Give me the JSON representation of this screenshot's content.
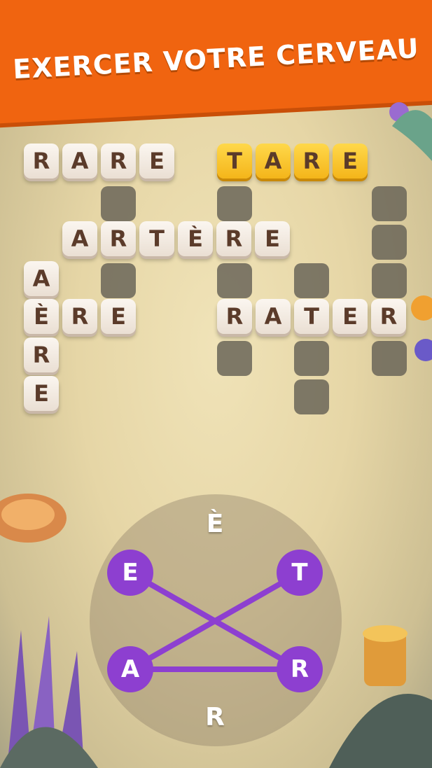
{
  "banner": {
    "title": "EXERCER VOTRE CERVEAU"
  },
  "board": {
    "words": [
      {
        "word": "RARE",
        "letters": [
          "R",
          "A",
          "R",
          "E"
        ]
      },
      {
        "word": "TARE",
        "letters": [
          "T",
          "A",
          "R",
          "E"
        ],
        "status": "highlighted"
      },
      {
        "word": "ARTÈRE",
        "letters": [
          "A",
          "R",
          "T",
          "È",
          "R",
          "E"
        ]
      },
      {
        "word": "AÈRE",
        "letters": [
          "A",
          "È",
          "R",
          "E"
        ]
      },
      {
        "word": "ÈRE",
        "letters": [
          "È",
          "R",
          "E"
        ]
      },
      {
        "word": "RATER",
        "letters": [
          "R",
          "A",
          "T",
          "E",
          "R"
        ]
      }
    ]
  },
  "wheel": {
    "letters": {
      "top": "È",
      "bottom": "R"
    },
    "selected_nodes": [
      "E",
      "T",
      "A",
      "R"
    ],
    "selection_color": "#8d3fd0"
  }
}
